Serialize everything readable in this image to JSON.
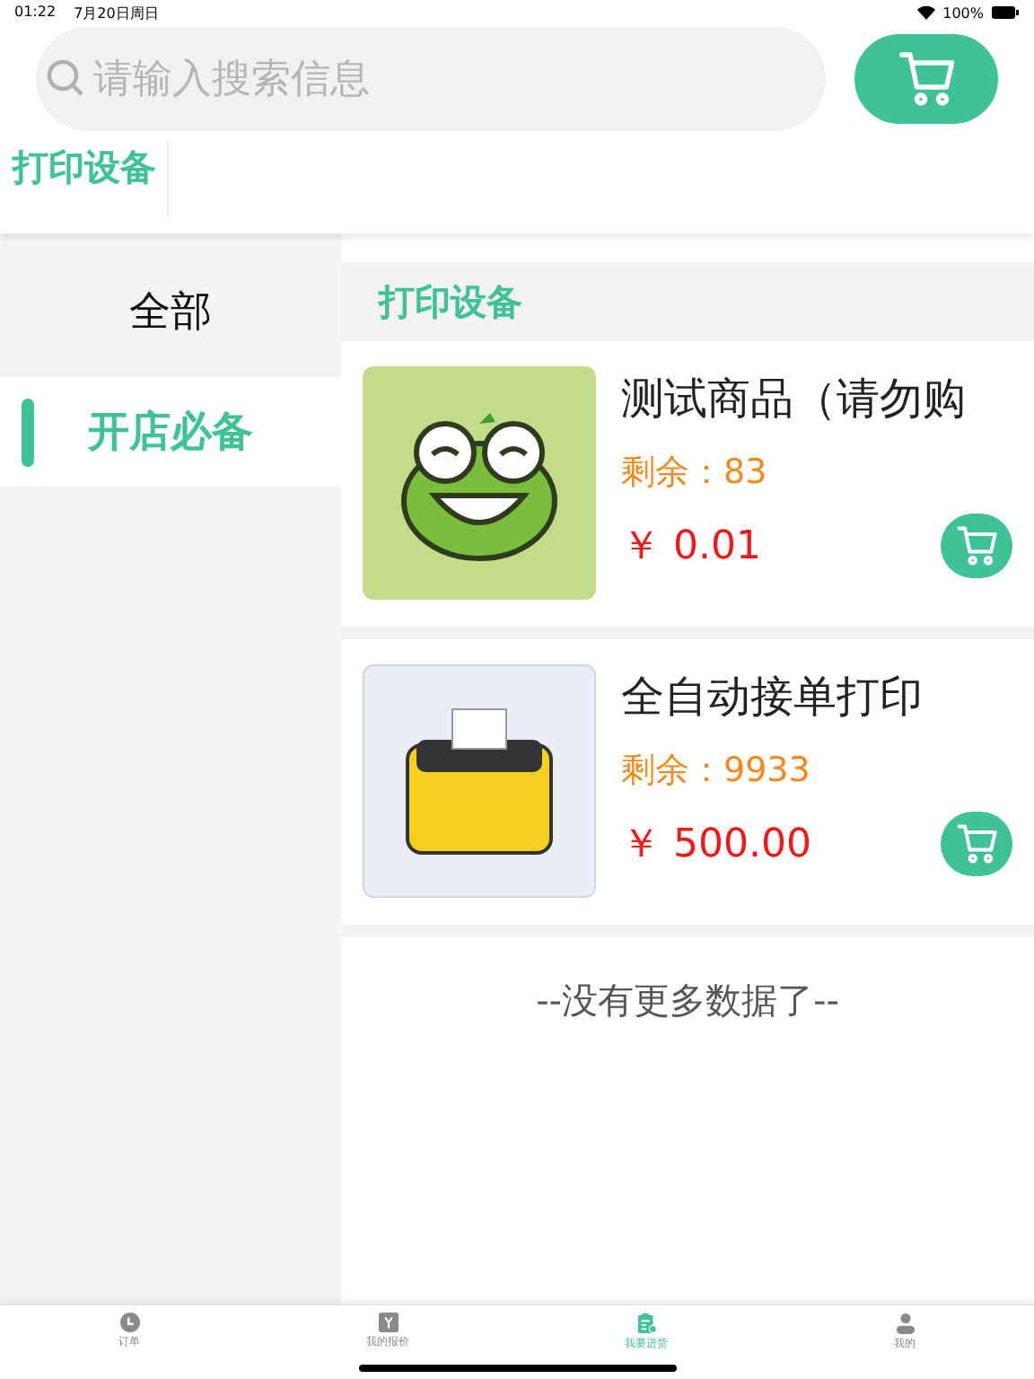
{
  "status_bar": {
    "time": "01:22",
    "date": "7月20日周日",
    "battery": "100%"
  },
  "search": {
    "placeholder": "请输入搜索信息"
  },
  "category_tabs": [
    {
      "label": "打印设备",
      "selected": true
    }
  ],
  "sidebar": {
    "items": [
      {
        "label": "全部",
        "selected": false
      },
      {
        "label": "开店必备",
        "selected": true
      }
    ]
  },
  "section": {
    "title": "打印设备"
  },
  "products": [
    {
      "name": "测试商品（请勿购",
      "stock": "剩余：83",
      "price": "￥ 0.01",
      "kind": "frog"
    },
    {
      "name": "全自动接单打印",
      "stock": "剩余：9933",
      "price": "￥ 500.00",
      "kind": "printer"
    }
  ],
  "footer": "--没有更多数据了--",
  "tab_bar": [
    {
      "label": "订单",
      "kind": "clock",
      "selected": false
    },
    {
      "label": "我的报价",
      "kind": "yen",
      "selected": false
    },
    {
      "label": "我要进货",
      "kind": "clipboard",
      "selected": true
    },
    {
      "label": "我的",
      "kind": "user",
      "selected": false
    }
  ]
}
